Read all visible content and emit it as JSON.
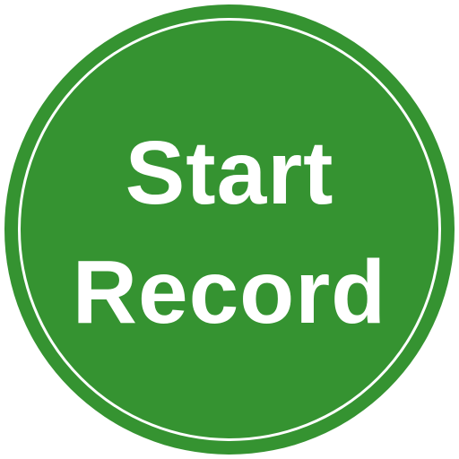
{
  "button": {
    "line1": "Start",
    "line2": "Record",
    "background_color": "#359331",
    "ring_color": "#ffffff",
    "text_color": "#ffffff"
  }
}
